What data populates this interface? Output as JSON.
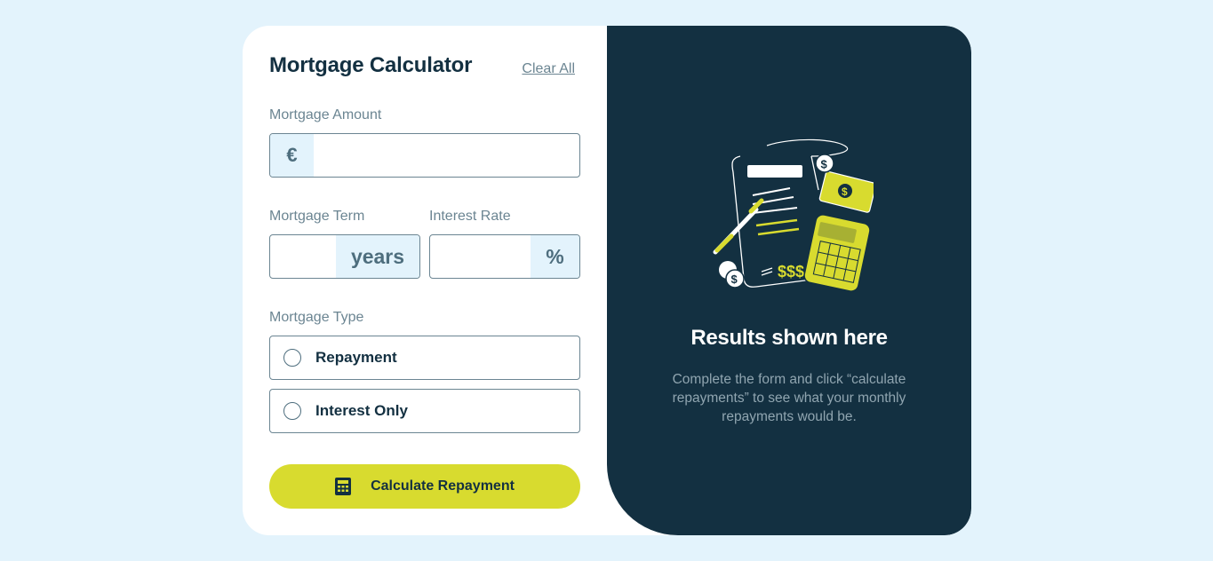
{
  "form": {
    "title": "Mortgage Calculator",
    "clear_all_label": "Clear All",
    "amount": {
      "label": "Mortgage Amount",
      "prefix": "€",
      "value": ""
    },
    "term": {
      "label": "Mortgage Term",
      "suffix": "years",
      "value": ""
    },
    "rate": {
      "label": "Interest Rate",
      "suffix": "%",
      "value": ""
    },
    "type": {
      "label": "Mortgage Type",
      "options": [
        {
          "label": "Repayment",
          "selected": false
        },
        {
          "label": "Interest Only",
          "selected": false
        }
      ]
    },
    "submit_label": "Calculate Repayment"
  },
  "results": {
    "title": "Results shown here",
    "description": "Complete the form and click “calculate repayments” to see what your monthly repayments would be.",
    "illustration_text": "$$$"
  },
  "colors": {
    "page_bg": "#e3f3fc",
    "dark": "#133041",
    "accent_lime": "#d8db2f",
    "muted": "#6b8592"
  }
}
